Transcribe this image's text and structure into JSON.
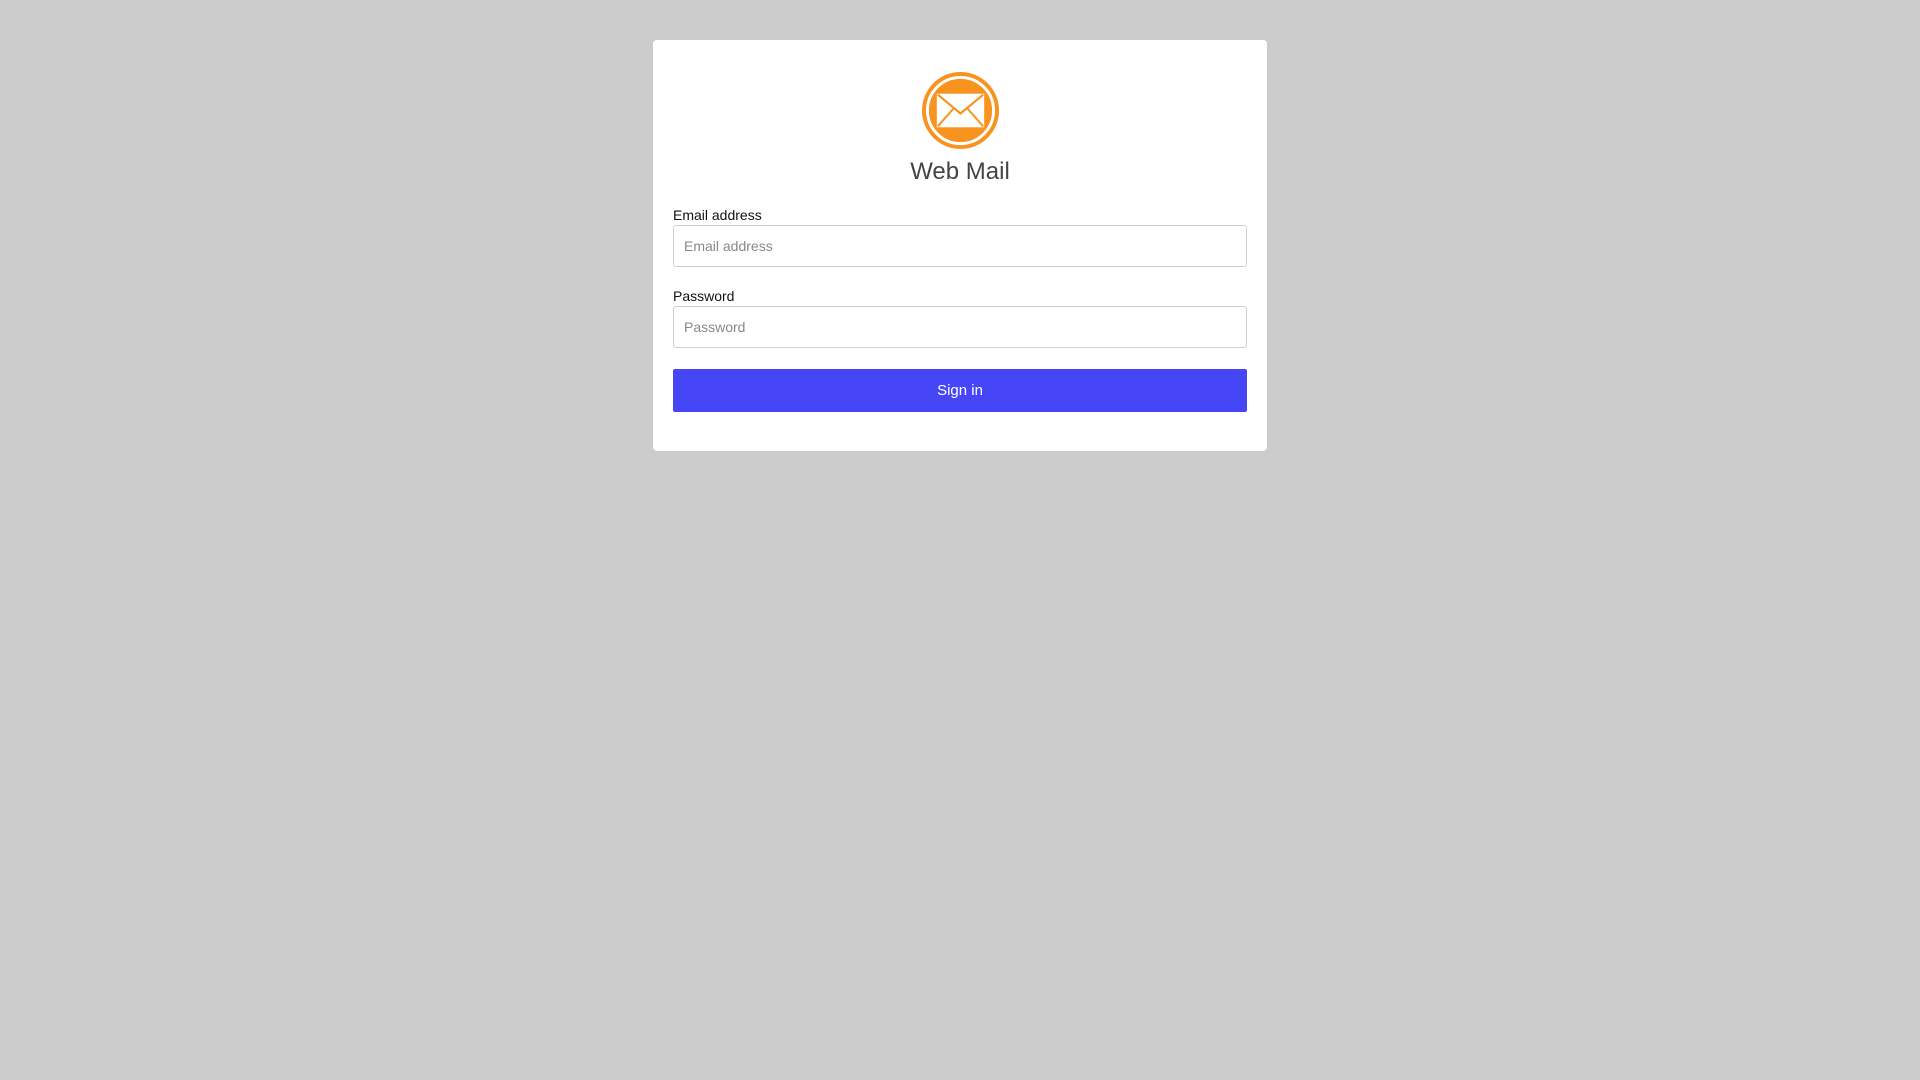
{
  "app": {
    "title": "Web Mail",
    "logo_icon": "mail-envelope-icon",
    "logo_color": "#f7931e"
  },
  "form": {
    "email": {
      "label": "Email address",
      "placeholder": "Email address",
      "value": ""
    },
    "password": {
      "label": "Password",
      "placeholder": "Password",
      "value": ""
    },
    "submit_label": "Sign in",
    "submit_color": "#4646f7"
  }
}
